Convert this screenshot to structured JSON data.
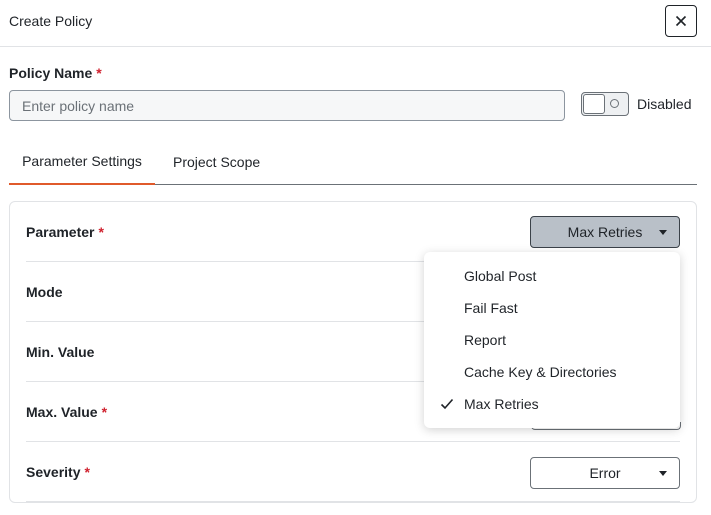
{
  "dialog": {
    "title": "Create Policy",
    "close_icon": "close-icon"
  },
  "policy_name": {
    "label": "Policy Name",
    "required_marker": "*",
    "placeholder": "Enter policy name",
    "value": ""
  },
  "status_toggle": {
    "label": "Disabled",
    "enabled": false
  },
  "tabs": [
    {
      "label": "Parameter Settings",
      "active": true
    },
    {
      "label": "Project Scope",
      "active": false
    }
  ],
  "settings": {
    "rows": [
      {
        "label": "Parameter",
        "required": "*",
        "value": "Max Retries"
      },
      {
        "label": "Mode",
        "required": ""
      },
      {
        "label": "Min. Value",
        "required": ""
      },
      {
        "label": "Max. Value",
        "required": "*"
      },
      {
        "label": "Severity",
        "required": "*",
        "value": "Error"
      }
    ]
  },
  "parameter_dropdown": {
    "open": true,
    "options": [
      "Global Post",
      "Fail Fast",
      "Report",
      "Cache Key & Directories",
      "Max Retries"
    ],
    "selected": "Max Retries",
    "check_icon": "checkmark-icon"
  },
  "colors": {
    "accent": "#e05a2b",
    "required": "#d0222f",
    "open_select_bg": "#b9c0c8"
  }
}
